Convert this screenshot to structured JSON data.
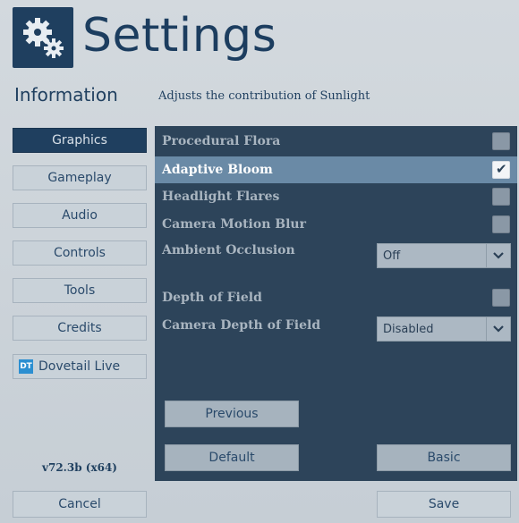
{
  "header": {
    "title": "Settings",
    "section_label": "Information",
    "description": "Adjusts the contribution of Sunlight"
  },
  "sidebar": {
    "items": [
      {
        "label": "Graphics",
        "active": true
      },
      {
        "label": "Gameplay"
      },
      {
        "label": "Audio"
      },
      {
        "label": "Controls"
      },
      {
        "label": "Tools"
      },
      {
        "label": "Credits"
      },
      {
        "label": "Dovetail Live",
        "logo_text": "DT"
      }
    ],
    "version": "v72.3b (x64)"
  },
  "settings": {
    "procedural_flora": {
      "label": "Procedural Flora",
      "checked": false
    },
    "adaptive_bloom": {
      "label": "Adaptive Bloom",
      "checked": true
    },
    "headlight_flares": {
      "label": "Headlight Flares",
      "checked": false
    },
    "camera_motion_blur": {
      "label": "Camera Motion Blur",
      "checked": false
    },
    "ambient_occlusion": {
      "label": "Ambient Occlusion",
      "value": "Off"
    },
    "depth_of_field": {
      "label": "Depth of Field",
      "checked": false
    },
    "camera_depth_of_field": {
      "label": "Camera Depth of Field",
      "value": "Disabled"
    }
  },
  "panel_buttons": {
    "previous": "Previous",
    "default": "Default",
    "basic": "Basic"
  },
  "footer": {
    "cancel": "Cancel",
    "save": "Save"
  },
  "icons": {
    "logo": "gears-icon",
    "checkmark": "checkmark-icon",
    "dropdown": "chevron-down-icon"
  }
}
